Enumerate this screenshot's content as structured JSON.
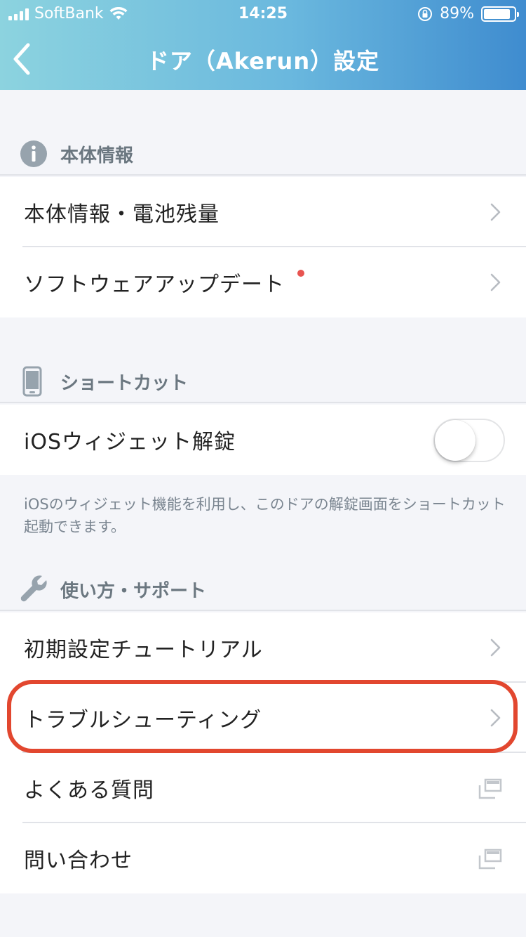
{
  "status_bar": {
    "carrier": "SoftBank",
    "time": "14:25",
    "battery_percent": "89%",
    "battery_level": 0.89
  },
  "nav": {
    "title": "ドア（Akerun）設定",
    "back_icon": "chevron-left-icon"
  },
  "sections": {
    "device_info": {
      "header": "本体情報",
      "icon": "info-icon",
      "items": [
        {
          "label": "本体情報・電池残量",
          "accessory": "chevron-right-icon"
        },
        {
          "label": "ソフトウェアアップデート",
          "accessory": "chevron-right-icon",
          "badge_color": "#e85450"
        }
      ]
    },
    "shortcut": {
      "header": "ショートカット",
      "icon": "phone-icon",
      "items": [
        {
          "label": "iOSウィジェット解錠",
          "toggle_on": false
        }
      ],
      "note": "iOSのウィジェット機能を利用し、このドアの解錠画面をショートカット起動できます。"
    },
    "support": {
      "header": "使い方・サポート",
      "icon": "wrench-icon",
      "items": [
        {
          "label": "初期設定チュートリアル",
          "accessory": "chevron-right-icon"
        },
        {
          "label": "トラブルシューティング",
          "accessory": "chevron-right-icon",
          "highlighted": true
        },
        {
          "label": "よくある質問",
          "accessory": "external-link-icon"
        },
        {
          "label": "問い合わせ",
          "accessory": "external-link-icon"
        }
      ]
    }
  },
  "colors": {
    "header_gradient_start": "#8cd3df",
    "header_gradient_end": "#3f8ccf",
    "highlight": "#e2472f",
    "badge": "#e85450",
    "background": "#f4f5f9"
  }
}
